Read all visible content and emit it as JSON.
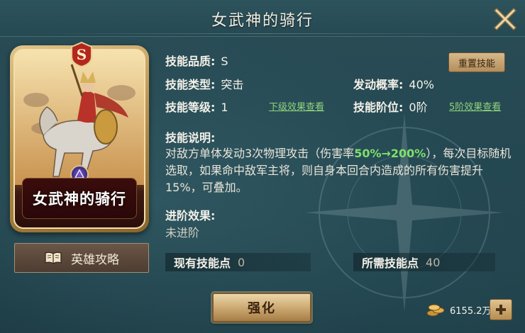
{
  "header": {
    "title": "女武神的骑行"
  },
  "card": {
    "grade": "S",
    "name": "女武神的骑行"
  },
  "buttons": {
    "strategy": "英雄攻略",
    "reset": "重置技能",
    "upgrade": "强化"
  },
  "skill": {
    "quality_label": "技能品质:",
    "quality_value": "S",
    "type_label": "技能类型:",
    "type_value": "突击",
    "chance_label": "发动概率:",
    "chance_value": "40%",
    "level_label": "技能等级:",
    "level_value": "1",
    "next_level_link": "下级效果查看",
    "tier_label": "技能阶位:",
    "tier_value": "0阶",
    "tier5_link": "5阶效果查看",
    "desc_title": "技能说明:",
    "desc_part1": "对敌方单体发动3次物理攻击（伤害率",
    "desc_highlight": "50%→200%",
    "desc_part2": "），每次目标随机选取，如果命中敌军主将，则自身本回合内造成的所有伤害提升15%，可叠加。",
    "advance_title": "进阶效果:",
    "advance_value": "未进阶"
  },
  "points": {
    "have_label": "现有技能点",
    "have_value": "0",
    "need_label": "所需技能点",
    "need_value": "40"
  },
  "currency": {
    "amount": "6155.2万"
  },
  "icons": {
    "close": "close-x-icon",
    "book": "book-icon",
    "coin": "coin-stack-icon",
    "plus": "plus-icon",
    "emblem": "faction-emblem-icon"
  },
  "colors": {
    "highlight": "#7fe06a",
    "link": "#8fd37a",
    "panel": "#244650",
    "gold": "#caa66f"
  }
}
